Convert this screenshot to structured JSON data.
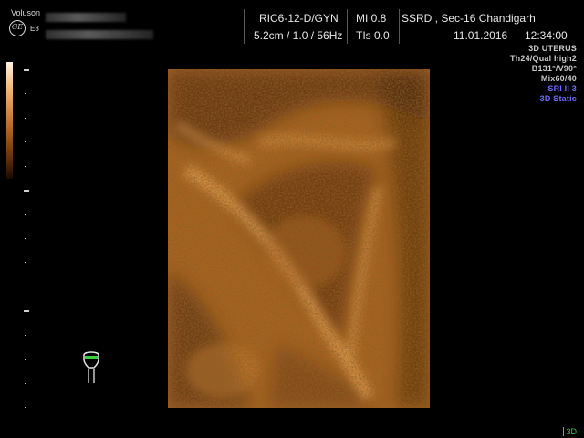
{
  "header": {
    "brand": "Voluson",
    "logo": "GE",
    "model": "E8",
    "probe": "RIC6-12-D/GYN",
    "mi": "MI  0.8",
    "location": "SSRD , Sec-16 Chandigarh",
    "depth": "5.2cm / 1.0 / 56Hz",
    "tis": "TIs  0.0",
    "date": "11.01.2016",
    "time": "12:34:00"
  },
  "info_panel": {
    "lines": [
      {
        "text": "3D UTERUS",
        "color": "#c8c8c8"
      },
      {
        "text": "Th24/Qual high2",
        "color": "#c8c8c8"
      },
      {
        "text": "B131°/V90°",
        "color": "#c8c8c8"
      },
      {
        "text": "Mix60/40",
        "color": "#c8c8c8"
      },
      {
        "text": "SRI II 3",
        "color": "#6f6cff"
      },
      {
        "text": "3D Static",
        "color": "#6f6cff"
      }
    ]
  },
  "mode_badge": "3D",
  "icons": {
    "logo": "ge-logo-icon",
    "probe": "probe-orientation-icon"
  },
  "colors": {
    "tissue_base": "#a8621f",
    "tissue_light": "#e9a55a",
    "tissue_dark": "#4a2408",
    "accent_green": "#3ccf3c",
    "accent_blue": "#6f6cff"
  }
}
